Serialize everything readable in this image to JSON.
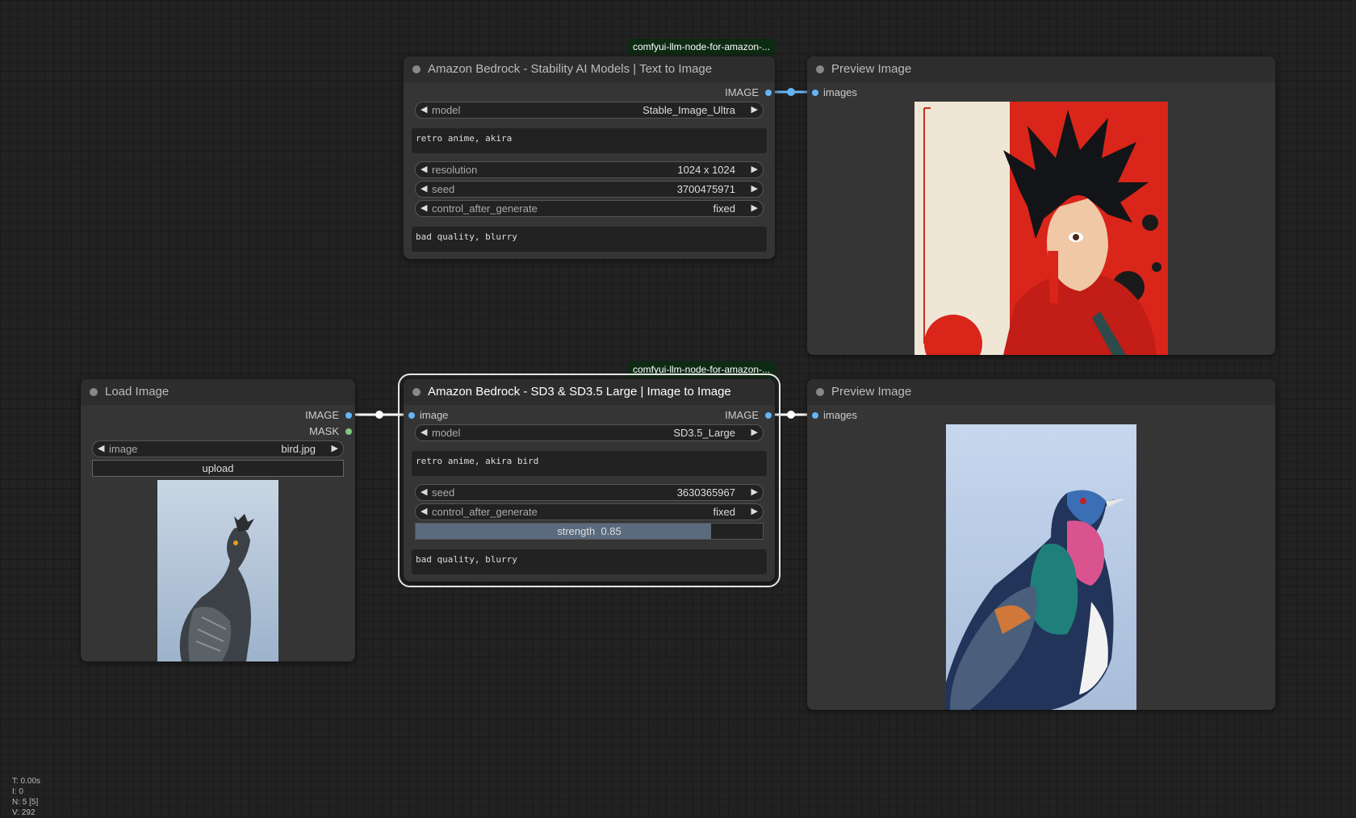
{
  "nodes": {
    "t2i": {
      "title": "Amazon Bedrock - Stability AI Models | Text to Image",
      "badge": "comfyui-llm-node-for-amazon-...",
      "output": "IMAGE",
      "model_label": "model",
      "model_value": "Stable_Image_Ultra",
      "prompt": "retro anime, akira",
      "resolution_label": "resolution",
      "resolution_value": "1024 x 1024",
      "seed_label": "seed",
      "seed_value": "3700475971",
      "control_label": "control_after_generate",
      "control_value": "fixed",
      "negative": "bad quality, blurry"
    },
    "preview1": {
      "title": "Preview Image",
      "input": "images"
    },
    "load": {
      "title": "Load Image",
      "out_image": "IMAGE",
      "out_mask": "MASK",
      "image_label": "image",
      "image_value": "bird.jpg",
      "upload_label": "upload"
    },
    "i2i": {
      "title": "Amazon Bedrock - SD3 & SD3.5 Large | Image to Image",
      "badge": "comfyui-llm-node-for-amazon-...",
      "input": "image",
      "output": "IMAGE",
      "model_label": "model",
      "model_value": "SD3.5_Large",
      "prompt": "retro anime, akira bird",
      "seed_label": "seed",
      "seed_value": "3630365967",
      "control_label": "control_after_generate",
      "control_value": "fixed",
      "strength_label": "strength",
      "strength_value": "0.85",
      "strength_fraction": 0.85,
      "negative": "bad quality, blurry"
    },
    "preview2": {
      "title": "Preview Image",
      "input": "images"
    }
  },
  "stats": {
    "t": "T: 0.00s",
    "i": "I: 0",
    "n": "N: 5 [5]",
    "v": "V: 292"
  },
  "colors": {
    "image_slot": "#64b5f6",
    "mask_slot": "#81c784",
    "link": "#ffffff",
    "link_preview": "#64b5f6"
  }
}
